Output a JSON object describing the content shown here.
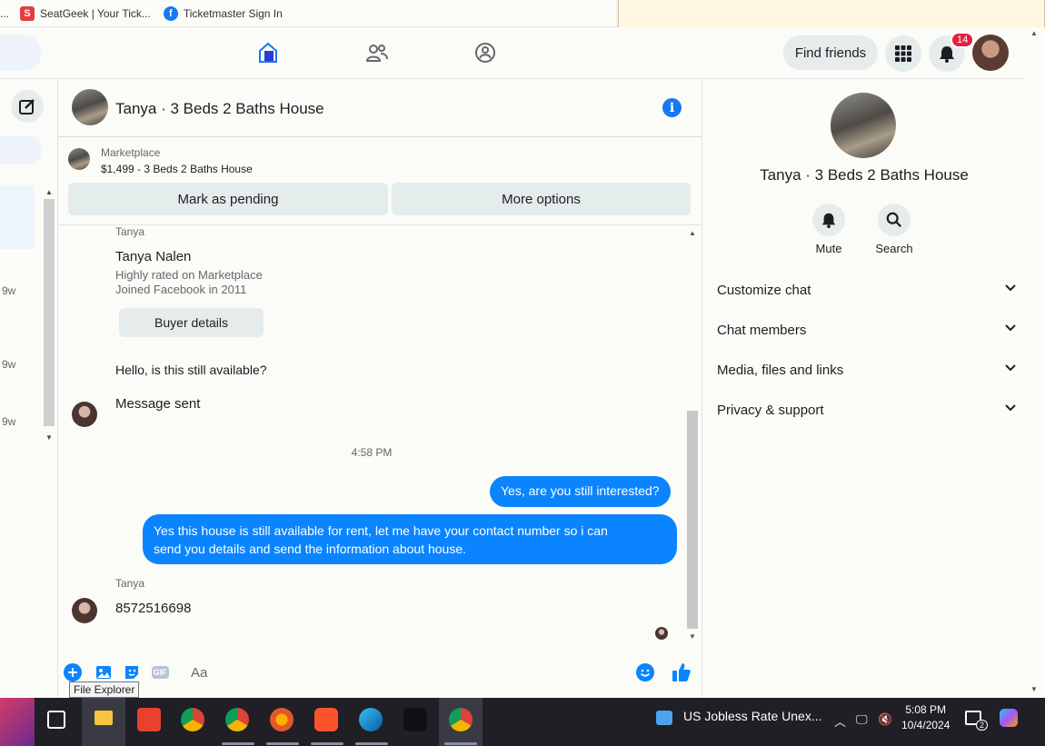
{
  "bookmarks": [
    {
      "label": "SeatGeek | Your Tick...",
      "icon": "seatgeek-icon",
      "glyph": "S"
    },
    {
      "label": "Ticketmaster Sign In",
      "icon": "facebook-icon",
      "glyph": "f"
    }
  ],
  "bookmarks_prefix": "...",
  "topnav": {
    "find_friends": "Find friends",
    "notification_count": "14"
  },
  "left_rail": {
    "times": [
      "9w",
      "9w",
      "9w"
    ]
  },
  "chat": {
    "title": "Tanya · 3 Beds 2 Baths House",
    "marketplace_label": "Marketplace",
    "listing": "$1,499 - 3 Beds 2 Baths House",
    "mark_pending": "Mark as pending",
    "more_options": "More options"
  },
  "buyer": {
    "sender": "Tanya",
    "name": "Tanya Nalen",
    "rating": "Highly rated on Marketplace",
    "joined": "Joined Facebook in 2011",
    "details_button": "Buyer details"
  },
  "messages": {
    "first": "Hello, is this still available?",
    "status": "Message sent",
    "timestamp": "4:58 PM",
    "outgoing_1": "Yes, are you still interested?",
    "outgoing_2_line1": "Yes this house is still available for rent, let me have your contact number so i can",
    "outgoing_2_line2": "send you details and send the information about house.",
    "reply_sender": "Tanya",
    "reply": "8572516698"
  },
  "composer": {
    "placeholder": "Aa",
    "gif": "GIF",
    "tooltip": "File Explorer"
  },
  "right_panel": {
    "title": "Tanya · 3 Beds 2 Baths House",
    "mute": "Mute",
    "search": "Search",
    "sections": [
      "Customize chat",
      "Chat members",
      "Media, files and links",
      "Privacy & support"
    ]
  },
  "taskbar": {
    "news": "US Jobless Rate Unex...",
    "time": "5:08 PM",
    "date": "10/4/2024",
    "notifications": "2"
  },
  "colors": {
    "accent": "#0a84ff",
    "brand": "#1877f2",
    "badge": "#e41e3f"
  }
}
